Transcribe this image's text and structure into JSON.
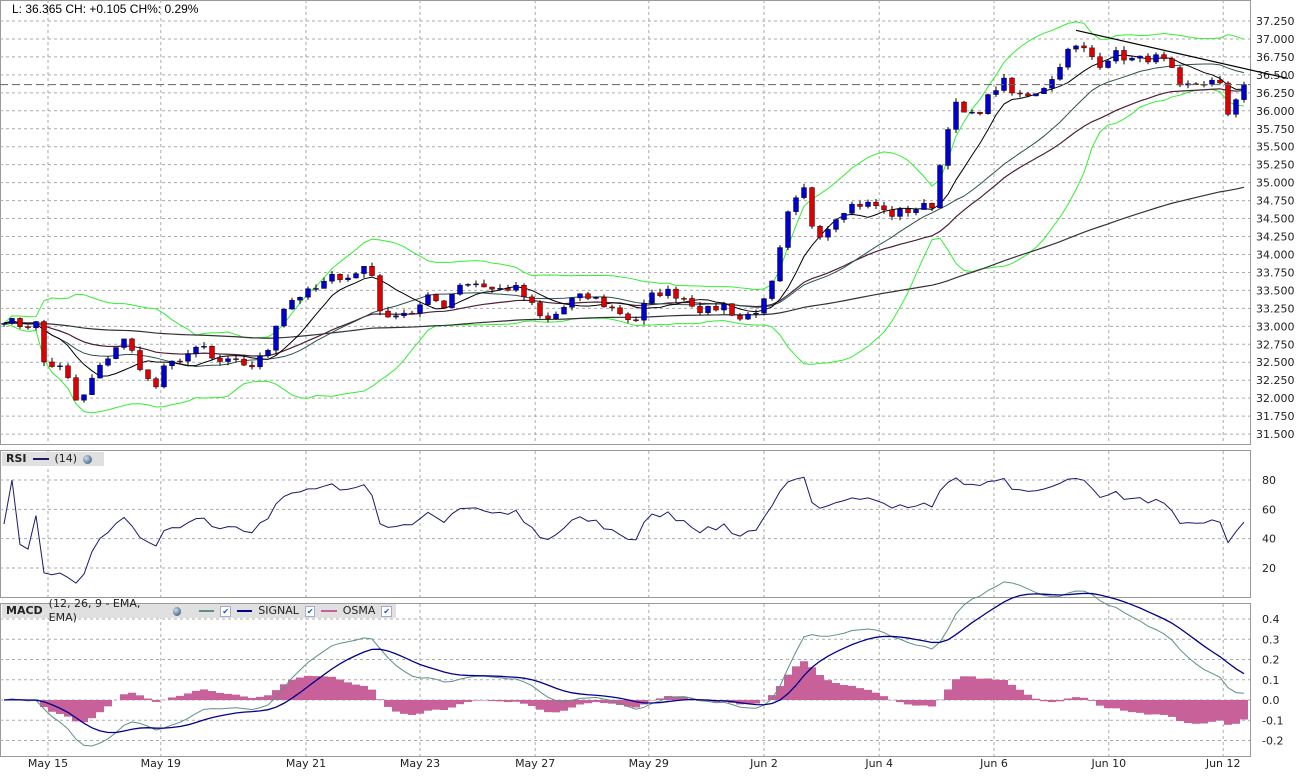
{
  "header": {
    "last": "L: 36.365",
    "change": "CH: +0.105",
    "change_pct": "CH%: 0.29%"
  },
  "rsi_panel": {
    "title": "RSI",
    "period": "(14)"
  },
  "macd_panel": {
    "title": "MACD",
    "params": "(12, 26, 9 - EMA, EMA)",
    "signal_label": "SIGNAL",
    "osma_label": "OSMA"
  },
  "colors": {
    "up": "#0000cc",
    "down": "#dd0000",
    "bollinger": "#33ee33",
    "rsi": "#1a1a6e",
    "macd": "#5f8f8a",
    "signal": "#00008b",
    "osma": "#c8619a",
    "grid": "#aaaaaa"
  },
  "chart_data": {
    "type": "candlestick",
    "title": "",
    "x_labels": [
      {
        "bar": 5.5,
        "label": "May 15"
      },
      {
        "bar": 19.6,
        "label": "May 19"
      },
      {
        "bar": 37.75,
        "label": "May 21"
      },
      {
        "bar": 52,
        "label": "May 23"
      },
      {
        "bar": 66.4,
        "label": "May 27"
      },
      {
        "bar": 80.6,
        "label": "May 29"
      },
      {
        "bar": 95,
        "label": "Jun 2"
      },
      {
        "bar": 109.4,
        "label": "Jun 4"
      },
      {
        "bar": 123.75,
        "label": "Jun 6"
      },
      {
        "bar": 138.1,
        "label": "Jun 10"
      },
      {
        "bar": 152.4,
        "label": "Jun 12"
      }
    ],
    "price_ticks": [
      "37.250",
      "37.000",
      "36.750",
      "36.500",
      "36.250",
      "36.000",
      "35.750",
      "35.500",
      "35.250",
      "35.000",
      "34.750",
      "34.500",
      "34.250",
      "34.000",
      "33.750",
      "33.500",
      "33.250",
      "33.000",
      "32.750",
      "32.500",
      "32.250",
      "32.000",
      "31.750",
      "31.500"
    ],
    "price_range": [
      31.5,
      37.25
    ],
    "last_price": 36.365,
    "close_keypoints": [
      [
        0,
        33.1
      ],
      [
        2.5,
        33.0
      ],
      [
        4.4,
        33.05
      ],
      [
        5,
        32.5
      ],
      [
        7.5,
        32.4
      ],
      [
        9.4,
        31.85
      ],
      [
        10.6,
        32.2
      ],
      [
        12.5,
        32.5
      ],
      [
        13.75,
        32.7
      ],
      [
        15,
        32.8
      ],
      [
        16.25,
        32.6
      ],
      [
        18.75,
        32.1
      ],
      [
        20,
        32.4
      ],
      [
        22.5,
        32.6
      ],
      [
        25,
        32.7
      ],
      [
        26.25,
        32.5
      ],
      [
        28.75,
        32.5
      ],
      [
        31.25,
        32.45
      ],
      [
        33.1,
        32.7
      ],
      [
        34.4,
        33.2
      ],
      [
        36.25,
        33.4
      ],
      [
        38.75,
        33.5
      ],
      [
        41.25,
        33.7
      ],
      [
        43.75,
        33.7
      ],
      [
        45.6,
        33.9
      ],
      [
        46.9,
        33.3
      ],
      [
        47.5,
        33.0
      ],
      [
        48.75,
        33.2
      ],
      [
        51.25,
        33.2
      ],
      [
        53.1,
        33.4
      ],
      [
        55,
        33.3
      ],
      [
        56.9,
        33.6
      ],
      [
        59.4,
        33.6
      ],
      [
        61.25,
        33.5
      ],
      [
        63.75,
        33.55
      ],
      [
        65.6,
        33.35
      ],
      [
        67.5,
        33.05
      ],
      [
        69.4,
        33.2
      ],
      [
        71.25,
        33.4
      ],
      [
        73.75,
        33.4
      ],
      [
        75,
        33.3
      ],
      [
        76.9,
        33.2
      ],
      [
        78.75,
        33.05
      ],
      [
        80.6,
        33.4
      ],
      [
        82.5,
        33.5
      ],
      [
        85,
        33.4
      ],
      [
        87.5,
        33.2
      ],
      [
        90,
        33.3
      ],
      [
        91.9,
        33.1
      ],
      [
        93.75,
        33.2
      ],
      [
        95.6,
        33.4
      ],
      [
        96.9,
        34.0
      ],
      [
        98.1,
        34.6
      ],
      [
        100,
        34.9
      ],
      [
        101.25,
        34.3
      ],
      [
        102.5,
        34.3
      ],
      [
        104.4,
        34.6
      ],
      [
        106.25,
        34.7
      ],
      [
        108.75,
        34.7
      ],
      [
        110.6,
        34.55
      ],
      [
        112.5,
        34.6
      ],
      [
        116.25,
        34.7
      ],
      [
        117.5,
        35.6
      ],
      [
        118.75,
        36.1
      ],
      [
        120.6,
        35.9
      ],
      [
        121.9,
        36.0
      ],
      [
        123.75,
        36.3
      ],
      [
        125,
        36.4
      ],
      [
        126.25,
        36.2
      ],
      [
        128.75,
        36.25
      ],
      [
        131.25,
        36.45
      ],
      [
        132.5,
        36.8
      ],
      [
        134.4,
        36.9
      ],
      [
        135.6,
        36.8
      ],
      [
        136.9,
        36.65
      ],
      [
        138.75,
        36.8
      ],
      [
        141.25,
        36.7
      ],
      [
        143.75,
        36.75
      ],
      [
        145.6,
        36.65
      ],
      [
        146.9,
        36.3
      ],
      [
        148.1,
        36.35
      ],
      [
        150,
        36.4
      ],
      [
        151.9,
        36.4
      ],
      [
        152.75,
        35.9
      ],
      [
        153.75,
        36.15
      ],
      [
        154.75,
        36.3
      ],
      [
        155.25,
        36.365
      ]
    ],
    "trendline": [
      [
        134,
        37.12
      ],
      [
        160.5,
        36.45
      ]
    ],
    "rsi": {
      "period": 14,
      "ticks": [
        "80",
        "60",
        "40",
        "20"
      ],
      "range": [
        0,
        100
      ]
    },
    "macd": {
      "fast": 12,
      "slow": 26,
      "signal": 9,
      "ticks": [
        "0.4",
        "0.3",
        "0.2",
        "0.1",
        "0.0",
        "-0.1",
        "-0.2"
      ],
      "range": [
        -0.28,
        0.48
      ]
    }
  }
}
